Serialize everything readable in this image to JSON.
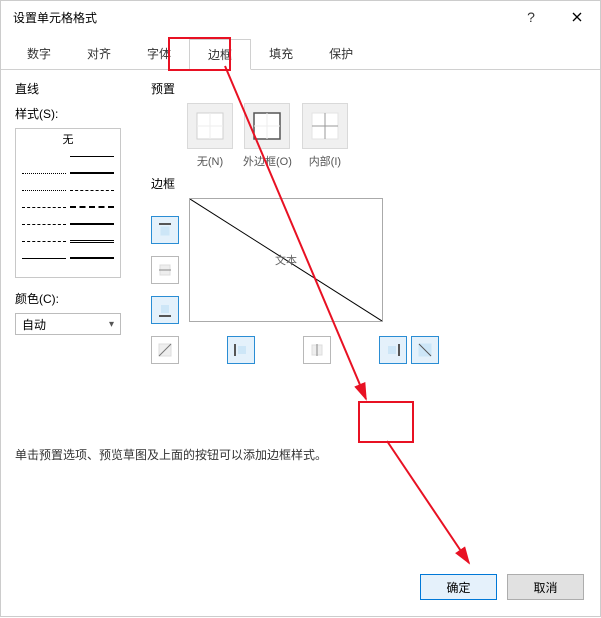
{
  "window": {
    "title": "设置单元格格式"
  },
  "tabs": [
    {
      "label": "数字"
    },
    {
      "label": "对齐"
    },
    {
      "label": "字体"
    },
    {
      "label": "边框"
    },
    {
      "label": "填充"
    },
    {
      "label": "保护"
    }
  ],
  "line_section": {
    "heading": "直线",
    "style_label": "样式(S):",
    "none_label": "无",
    "color_label": "颜色(C):",
    "color_value": "自动"
  },
  "preset_section": {
    "heading": "预置",
    "items": [
      {
        "label": "无(N)"
      },
      {
        "label": "外边框(O)"
      },
      {
        "label": "内部(I)"
      }
    ]
  },
  "border_section": {
    "heading": "边框",
    "preview_text": "文本"
  },
  "hint": "单击预置选项、预览草图及上面的按钮可以添加边框样式。",
  "buttons": {
    "ok": "确定",
    "cancel": "取消"
  }
}
